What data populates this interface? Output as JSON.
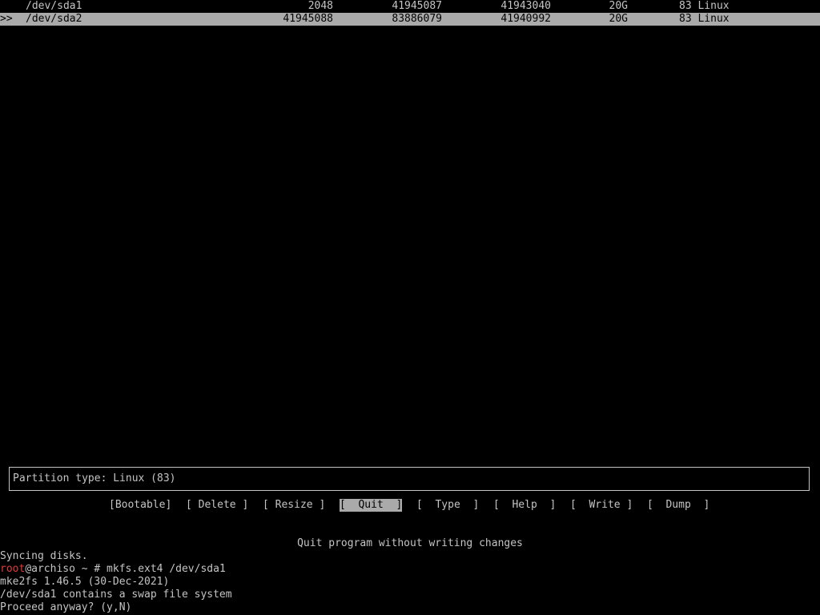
{
  "partitions": [
    {
      "marker": "",
      "device": "/dev/sda1",
      "start": "2048",
      "end": "41945087",
      "sectors": "41943040",
      "size": "20G",
      "type": "83 Linux",
      "selected": false
    },
    {
      "marker": ">>",
      "device": "/dev/sda2",
      "start": "41945088",
      "end": "83886079",
      "sectors": "41940992",
      "size": "20G",
      "type": "83 Linux",
      "selected": true
    }
  ],
  "info_box": {
    "text": "Partition type: Linux (83)"
  },
  "menu": {
    "bootable": "[Bootable]",
    "delete": "[ Delete ]",
    "resize": "[ Resize ]",
    "quit": "[  Quit  ]",
    "type": "[  Type  ]",
    "help": "[  Help  ]",
    "write": "[  Write ]",
    "dump": "[  Dump  ]",
    "active": "quit"
  },
  "hint": "Quit program without writing changes",
  "terminal": {
    "line1": "Syncing disks.",
    "prompt_user": "root",
    "prompt_rest": "@archiso ~ # mkfs.ext4 /dev/sda1",
    "line3": "mke2fs 1.46.5 (30-Dec-2021)",
    "line4": "/dev/sda1 contains a swap file system",
    "line5": "Proceed anyway? (y,N)"
  },
  "colors": {
    "background": "#000000",
    "text": "#c4c4c4",
    "highlight": "#aaaaaa",
    "prompt_user": "#e03b3b"
  }
}
